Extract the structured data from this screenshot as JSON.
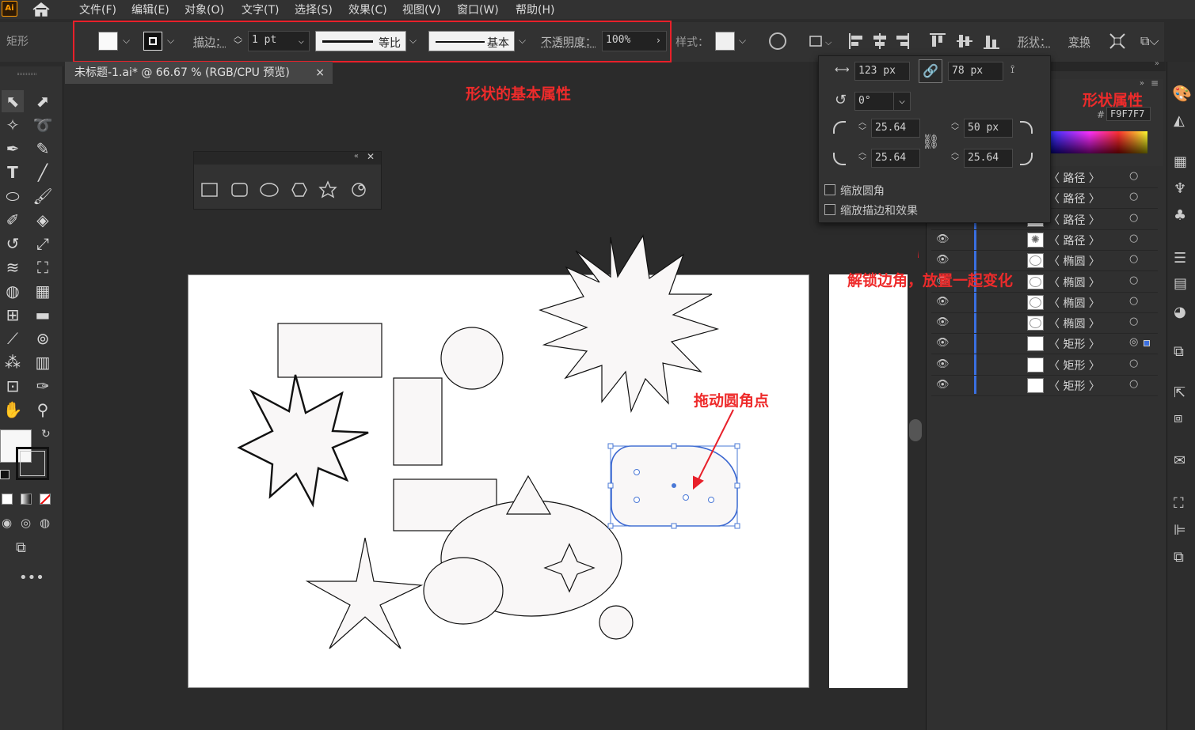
{
  "app": {
    "logo": "Ai"
  },
  "menu": [
    "文件(F)",
    "编辑(E)",
    "对象(O)",
    "文字(T)",
    "选择(S)",
    "效果(C)",
    "视图(V)",
    "窗口(W)",
    "帮助(H)"
  ],
  "control_bar": {
    "selection_type": "矩形",
    "stroke_label": "描边：",
    "stroke_weight": "1 pt",
    "stroke_profile": "等比",
    "brush_label": "基本",
    "opacity_label": "不透明度：",
    "opacity_value": "100%",
    "style_label": "样式：",
    "shape_label": "形状：",
    "transform_label": "变换"
  },
  "document_tab": {
    "title": "未标题-1.ai* @ 66.67 % (RGB/CPU 预览)",
    "close": "×"
  },
  "shape_properties": {
    "width": "123 px",
    "height": "78 px",
    "rotation": "0°",
    "corner_tl": "25.64",
    "corner_tr": "50 px",
    "corner_bl": "25.64",
    "corner_br": "25.64",
    "scale_corners_label": "缩放圆角",
    "scale_strokes_label": "缩放描边和效果"
  },
  "color_panel": {
    "hex_prefix": "#",
    "hex": "F9F7F7"
  },
  "layers": [
    {
      "name": "〈 路径 〉",
      "thumb": "blank",
      "eye": false
    },
    {
      "name": "〈 路径 〉",
      "thumb": "blank",
      "eye": false
    },
    {
      "name": "〈 路径 〉",
      "thumb": "blank",
      "eye": false
    },
    {
      "name": "〈 路径 〉",
      "thumb": "star",
      "eye": true
    },
    {
      "name": "〈 椭圆 〉",
      "thumb": "ellipse",
      "eye": true
    },
    {
      "name": "〈 椭圆 〉",
      "thumb": "ellipse",
      "eye": true
    },
    {
      "name": "〈 椭圆 〉",
      "thumb": "ellipse",
      "eye": true
    },
    {
      "name": "〈 椭圆 〉",
      "thumb": "ellipse",
      "eye": true
    },
    {
      "name": "〈 矩形 〉",
      "thumb": "rect",
      "eye": true,
      "selected": true
    },
    {
      "name": "〈 矩形 〉",
      "thumb": "rect",
      "eye": true
    },
    {
      "name": "〈 矩形 〉",
      "thumb": "rect",
      "eye": true
    }
  ],
  "annotations": {
    "basic_props": "形状的基本属性",
    "shape_props": "形状属性",
    "unlock_corners": "解锁边角，放置一起变化",
    "drag_corner": "拖动圆角点"
  },
  "colors": {
    "annotation_red": "#e8202a",
    "selection_blue": "#4a78d6",
    "fill": "#f9f7f7"
  }
}
